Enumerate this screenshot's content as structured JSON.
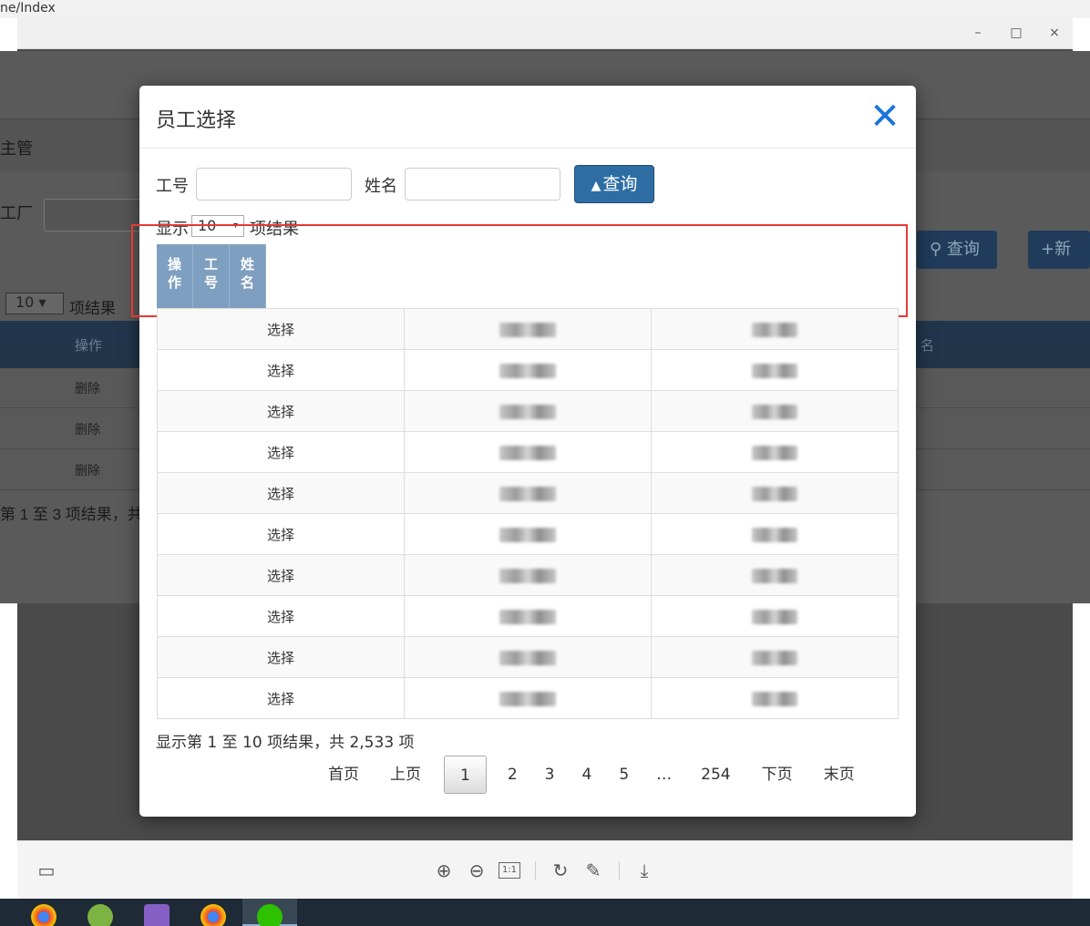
{
  "browser": {
    "url_fragment": "ne/Index"
  },
  "window_controls": {
    "minimize": "–",
    "maximize": "□",
    "close": "×"
  },
  "background_page": {
    "header_text": "主管",
    "factory_label": "工厂",
    "query_label": "查询",
    "new_label": "新",
    "show_prefix": "1",
    "page_length": "10",
    "show_suffix": "项结果",
    "column_operation": "操作",
    "column_name_partial": "名",
    "row_action": "删除",
    "info": "第 1 至 3 项结果，共"
  },
  "modal": {
    "title": "员工选择",
    "close_icon": "✕",
    "emp_no_label": "工号",
    "name_label": "姓名",
    "emp_no_value": "",
    "name_value": "",
    "query_button": "查询",
    "show_label": "显示",
    "page_length": "10",
    "show_suffix": "项结果",
    "columns": [
      "操作",
      "工号",
      "姓名"
    ],
    "column_chars": [
      [
        "操",
        "作"
      ],
      [
        "工",
        "号"
      ],
      [
        "姓",
        "名"
      ]
    ],
    "rows": [
      {
        "action": "选择"
      },
      {
        "action": "选择"
      },
      {
        "action": "选择"
      },
      {
        "action": "选择"
      },
      {
        "action": "选择"
      },
      {
        "action": "选择"
      },
      {
        "action": "选择"
      },
      {
        "action": "选择"
      },
      {
        "action": "选择"
      },
      {
        "action": "选择"
      }
    ],
    "info": "显示第 1 至 10 项结果，共 2,533 项",
    "pagination": {
      "first": "首页",
      "prev": "上页",
      "pages": [
        "1",
        "2",
        "3",
        "4",
        "5"
      ],
      "ellipsis": "…",
      "last_page": "254",
      "next": "下页",
      "last": "末页",
      "current": "1"
    }
  },
  "viewer_toolbar": {
    "icons": [
      "layout-icon",
      "zoom-in-icon",
      "zoom-out-icon",
      "actual-size-icon",
      "rotate-icon",
      "edit-icon",
      "download-icon"
    ],
    "actual_size_label": "1:1"
  },
  "colors": {
    "primary_button": "#2e6da4",
    "close_icon": "#1a73d9",
    "highlight_box": "#e53935",
    "mini_header": "#7f9fc0"
  }
}
